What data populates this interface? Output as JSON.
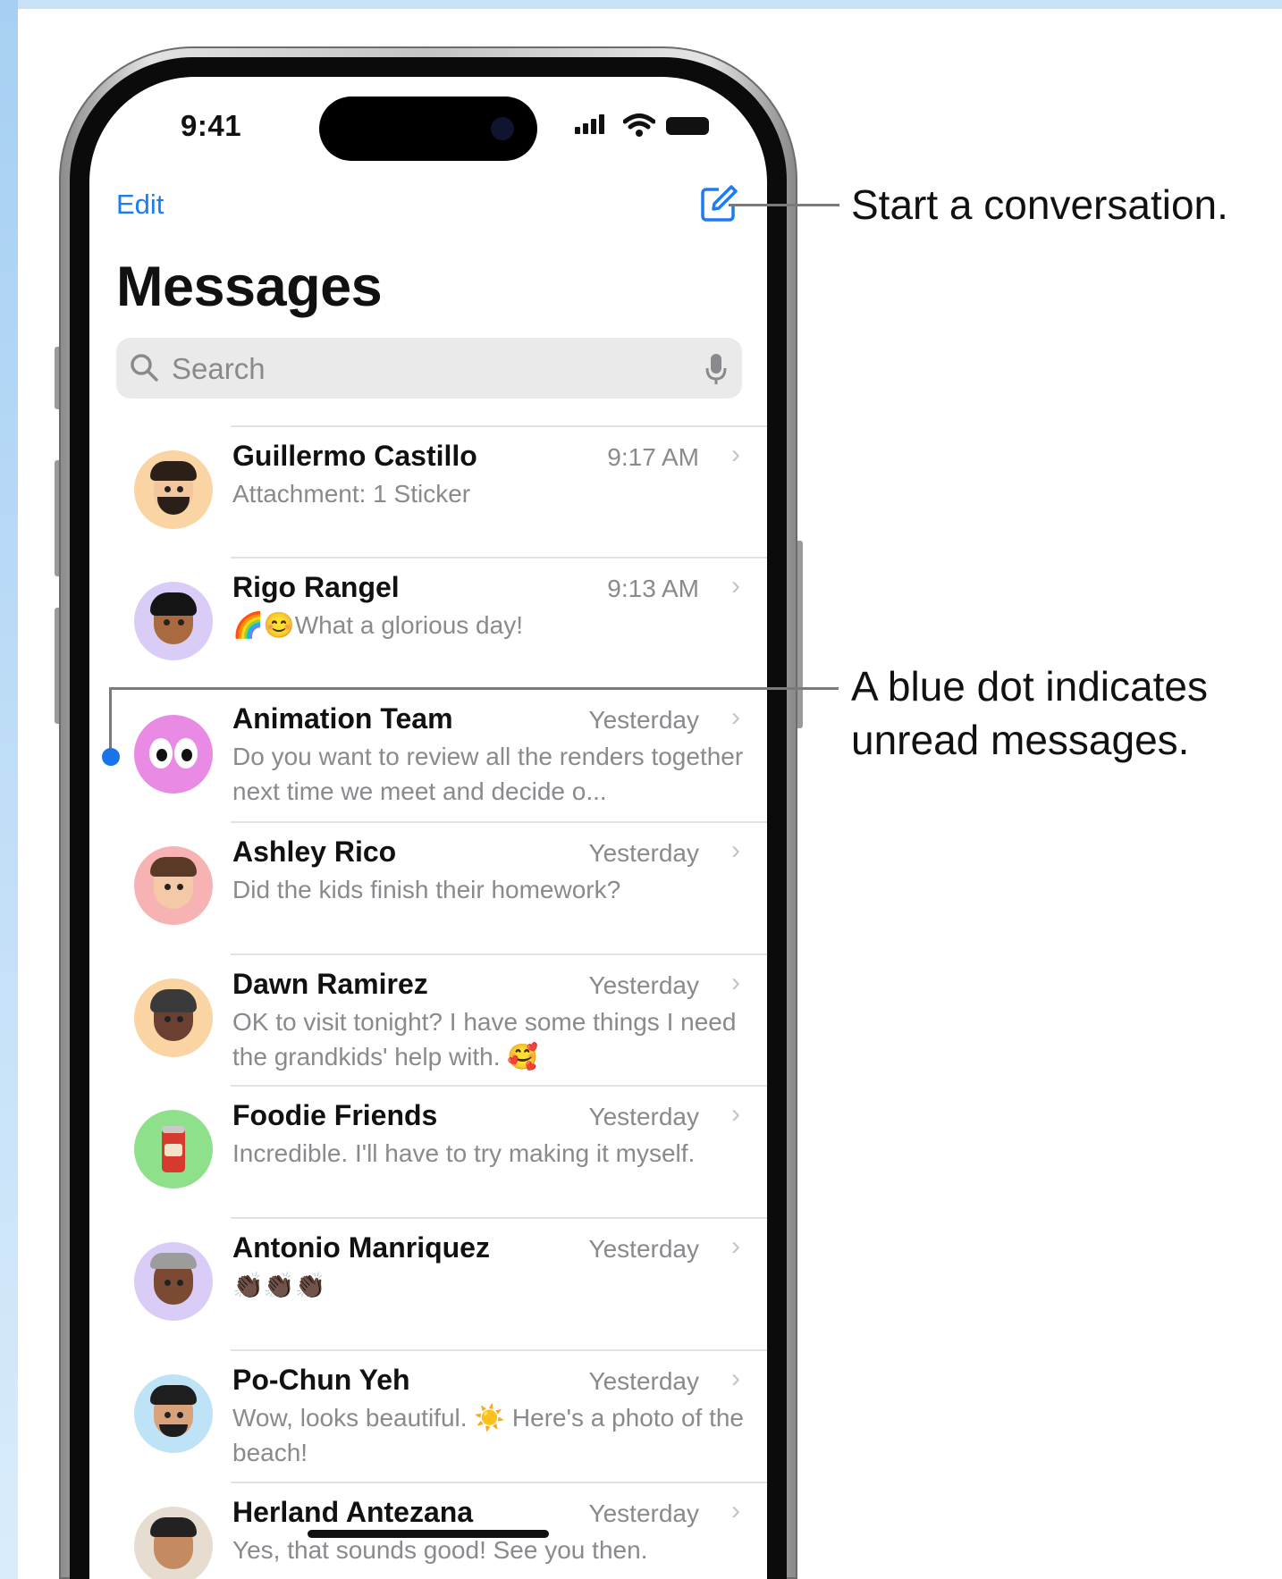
{
  "status_bar": {
    "time": "9:41"
  },
  "nav": {
    "edit_label": "Edit",
    "compose_icon": "compose-icon"
  },
  "page": {
    "title": "Messages"
  },
  "search": {
    "placeholder": "Search"
  },
  "conversations": [
    {
      "name": "Guillermo Castillo",
      "time": "9:17 AM",
      "preview": "Attachment: 1 Sticker",
      "avatar_color": "#fbd4a4",
      "unread": false
    },
    {
      "name": "Rigo Rangel",
      "time": "9:13 AM",
      "preview_emoji": "🌈😊",
      "preview": "What a glorious day!",
      "avatar_color": "#d9ccf6",
      "unread": false
    },
    {
      "name": "Animation Team",
      "time": "Yesterday",
      "preview": "Do you want to review all the renders together next time we meet and decide o...",
      "avatar_color": "#e98be4",
      "unread": true
    },
    {
      "name": "Ashley Rico",
      "time": "Yesterday",
      "preview": "Did the kids finish their homework?",
      "avatar_color": "#f7b3b3",
      "unread": false
    },
    {
      "name": "Dawn Ramirez",
      "time": "Yesterday",
      "preview": "OK to visit tonight? I have some things I need the grandkids' help with. 🥰",
      "avatar_color": "#fbd4a4",
      "unread": false
    },
    {
      "name": "Foodie Friends",
      "time": "Yesterday",
      "preview": "Incredible. I'll have to try making it myself.",
      "avatar_color": "#8fe08a",
      "unread": false
    },
    {
      "name": "Antonio Manriquez",
      "time": "Yesterday",
      "preview": "👏🏿👏🏿👏🏿",
      "avatar_color": "#d9ccf6",
      "unread": false
    },
    {
      "name": "Po-Chun Yeh",
      "time": "Yesterday",
      "preview": "Wow, looks beautiful. ☀️ Here's a photo of the beach!",
      "avatar_color": "#bfe3f6",
      "unread": false
    },
    {
      "name": "Herland Antezana",
      "time": "Yesterday",
      "preview": "Yes, that sounds good! See you then.",
      "avatar_color": "#e6dccf",
      "unread": false
    }
  ],
  "callouts": {
    "compose": "Start a conversation.",
    "unread_line1": "A blue dot indicates",
    "unread_line2": "unread messages."
  },
  "colors": {
    "accent": "#1d7cf2",
    "unread_dot": "#1a73e8",
    "background": "#b9daf6"
  }
}
